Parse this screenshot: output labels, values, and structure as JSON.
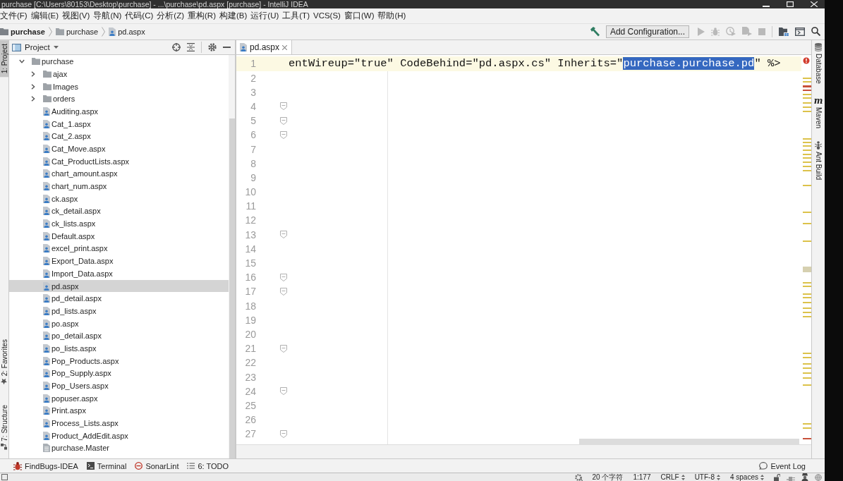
{
  "window": {
    "title": "purchase [C:\\Users\\80153\\Desktop\\purchase] - ...\\purchase\\pd.aspx [purchase] - IntelliJ IDEA"
  },
  "menu": [
    "文件(F)",
    "编辑(E)",
    "视图(V)",
    "导航(N)",
    "代码(C)",
    "分析(Z)",
    "重构(R)",
    "构建(B)",
    "运行(U)",
    "工具(T)",
    "VCS(S)",
    "窗口(W)",
    "帮助(H)"
  ],
  "breadcrumbs": [
    {
      "label": "purchase",
      "kind": "project"
    },
    {
      "label": "purchase",
      "kind": "folder"
    },
    {
      "label": "pd.aspx",
      "kind": "file"
    }
  ],
  "toolbar": {
    "configuration": "Add Configuration...",
    "run_buttons": [
      {
        "disabled": true
      },
      {
        "disabled": true
      },
      {
        "disabled": true
      },
      {
        "disabled": true
      },
      {
        "disabled": true
      }
    ]
  },
  "left_strip": [
    {
      "label": "1: Project",
      "kind": "project",
      "selected": true
    },
    {
      "label": "2: Favorites",
      "kind": "favorites",
      "selected": false
    },
    {
      "label": "7: Structure",
      "kind": "structure",
      "selected": false
    }
  ],
  "project_panel": {
    "title": "Project",
    "tree": [
      {
        "label": "purchase",
        "kind": "folder",
        "expanded": true,
        "selected": false,
        "children": [
          {
            "label": "ajax",
            "kind": "folder",
            "expanded": false,
            "selected": false
          },
          {
            "label": "Images",
            "kind": "folder",
            "expanded": false,
            "selected": false
          },
          {
            "label": "orders",
            "kind": "folder",
            "expanded": false,
            "selected": false
          },
          {
            "label": "Auditing.aspx",
            "kind": "aspx",
            "selected": false
          },
          {
            "label": "Cat_1.aspx",
            "kind": "aspx",
            "selected": false
          },
          {
            "label": "Cat_2.aspx",
            "kind": "aspx",
            "selected": false
          },
          {
            "label": "Cat_Move.aspx",
            "kind": "aspx",
            "selected": false
          },
          {
            "label": "Cat_ProductLists.aspx",
            "kind": "aspx",
            "selected": false
          },
          {
            "label": "chart_amount.aspx",
            "kind": "aspx",
            "selected": false
          },
          {
            "label": "chart_num.aspx",
            "kind": "aspx",
            "selected": false
          },
          {
            "label": "ck.aspx",
            "kind": "aspx",
            "selected": false
          },
          {
            "label": "ck_detail.aspx",
            "kind": "aspx",
            "selected": false
          },
          {
            "label": "ck_lists.aspx",
            "kind": "aspx",
            "selected": false
          },
          {
            "label": "Default.aspx",
            "kind": "aspx",
            "selected": false
          },
          {
            "label": "excel_print.aspx",
            "kind": "aspx",
            "selected": false
          },
          {
            "label": "Export_Data.aspx",
            "kind": "aspx",
            "selected": false
          },
          {
            "label": "Import_Data.aspx",
            "kind": "aspx",
            "selected": false
          },
          {
            "label": "pd.aspx",
            "kind": "aspx",
            "selected": true
          },
          {
            "label": "pd_detail.aspx",
            "kind": "aspx",
            "selected": false
          },
          {
            "label": "pd_lists.aspx",
            "kind": "aspx",
            "selected": false
          },
          {
            "label": "po.aspx",
            "kind": "aspx",
            "selected": false
          },
          {
            "label": "po_detail.aspx",
            "kind": "aspx",
            "selected": false
          },
          {
            "label": "po_lists.aspx",
            "kind": "aspx",
            "selected": false
          },
          {
            "label": "Pop_Products.aspx",
            "kind": "aspx",
            "selected": false
          },
          {
            "label": "Pop_Supply.aspx",
            "kind": "aspx",
            "selected": false
          },
          {
            "label": "Pop_Users.aspx",
            "kind": "aspx",
            "selected": false
          },
          {
            "label": "popuser.aspx",
            "kind": "aspx",
            "selected": false
          },
          {
            "label": "Print.aspx",
            "kind": "aspx",
            "selected": false
          },
          {
            "label": "Process_Lists.aspx",
            "kind": "aspx",
            "selected": false
          },
          {
            "label": "Product_AddEdit.aspx",
            "kind": "aspx",
            "selected": false
          },
          {
            "label": "purchase.Master",
            "kind": "master",
            "selected": false
          }
        ]
      }
    ]
  },
  "editor": {
    "tabs": [
      {
        "label": "pd.aspx",
        "selected": true
      }
    ],
    "lines": [
      {
        "number": "1",
        "current": true,
        "fold": false,
        "segments": [
          {
            "text": "entWireup=\"true\" CodeBehind=\"pd.aspx.cs\" Inherits=\"",
            "selected": false
          },
          {
            "text": "purchase.purchase.pd",
            "selected": true
          },
          {
            "text": "\" %>",
            "selected": false
          }
        ]
      },
      {
        "number": "2",
        "current": false,
        "fold": false
      },
      {
        "number": "3",
        "current": false,
        "fold": false
      },
      {
        "number": "4",
        "current": false,
        "fold": true
      },
      {
        "number": "5",
        "current": false,
        "fold": true
      },
      {
        "number": "6",
        "current": false,
        "fold": true
      },
      {
        "number": "7",
        "current": false,
        "fold": false
      },
      {
        "number": "8",
        "current": false,
        "fold": false
      },
      {
        "number": "9",
        "current": false,
        "fold": false
      },
      {
        "number": "10",
        "current": false,
        "fold": false
      },
      {
        "number": "11",
        "current": false,
        "fold": false
      },
      {
        "number": "12",
        "current": false,
        "fold": false
      },
      {
        "number": "13",
        "current": false,
        "fold": true
      },
      {
        "number": "14",
        "current": false,
        "fold": false
      },
      {
        "number": "15",
        "current": false,
        "fold": false
      },
      {
        "number": "16",
        "current": false,
        "fold": true
      },
      {
        "number": "17",
        "current": false,
        "fold": true
      },
      {
        "number": "18",
        "current": false,
        "fold": false
      },
      {
        "number": "19",
        "current": false,
        "fold": false
      },
      {
        "number": "20",
        "current": false,
        "fold": false
      },
      {
        "number": "21",
        "current": false,
        "fold": true
      },
      {
        "number": "22",
        "current": false,
        "fold": false
      },
      {
        "number": "23",
        "current": false,
        "fold": false
      },
      {
        "number": "24",
        "current": false,
        "fold": true
      },
      {
        "number": "25",
        "current": false,
        "fold": false
      },
      {
        "number": "26",
        "current": false,
        "fold": false
      },
      {
        "number": "27",
        "current": false,
        "fold": true
      }
    ]
  },
  "right_strip": [
    {
      "label": "Database",
      "kind": "database"
    },
    {
      "label": "Maven",
      "kind": "maven",
      "glyph": "m"
    },
    {
      "label": "Ant Build",
      "kind": "ant"
    }
  ],
  "bottom_tools": [
    {
      "label": "FindBugs-IDEA",
      "kind": "bug"
    },
    {
      "label": "Terminal",
      "kind": "terminal"
    },
    {
      "label": "SonarLint",
      "kind": "sonar"
    },
    {
      "label": "6: TODO",
      "kind": "todo"
    }
  ],
  "event_log": "Event Log",
  "status_bar": {
    "items": [
      {
        "label": "20 个字符",
        "kind": "text"
      },
      {
        "label": "1:177",
        "kind": "text"
      },
      {
        "label": "CRLF",
        "kind": "select"
      },
      {
        "label": "UTF-8",
        "kind": "select"
      },
      {
        "label": "4 spaces",
        "kind": "select"
      }
    ]
  }
}
